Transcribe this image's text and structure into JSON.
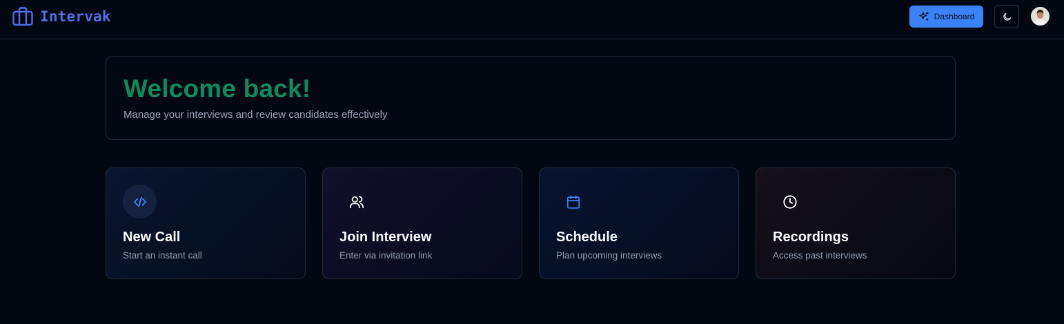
{
  "brand": {
    "name": "Intervak",
    "icon": "briefcase-icon",
    "color": "#4f6fe6"
  },
  "header": {
    "dashboard_label": "Dashboard",
    "dashboard_icon": "sparkles-icon",
    "theme_icon": "moon-icon",
    "accent": "#3b82f6"
  },
  "welcome": {
    "title": "Welcome back!",
    "subtitle": "Manage your interviews and review candidates effectively",
    "title_color": "#0f8a5f"
  },
  "actions": [
    {
      "title": "New Call",
      "subtitle": "Start an instant call",
      "icon": "code-icon",
      "icon_color": "#3b82f6"
    },
    {
      "title": "Join Interview",
      "subtitle": "Enter via invitation link",
      "icon": "users-icon",
      "icon_color": "#ffffff"
    },
    {
      "title": "Schedule",
      "subtitle": "Plan upcoming interviews",
      "icon": "calendar-icon",
      "icon_color": "#3b82f6"
    },
    {
      "title": "Recordings",
      "subtitle": "Access past interviews",
      "icon": "clock-icon",
      "icon_color": "#ffffff"
    }
  ]
}
